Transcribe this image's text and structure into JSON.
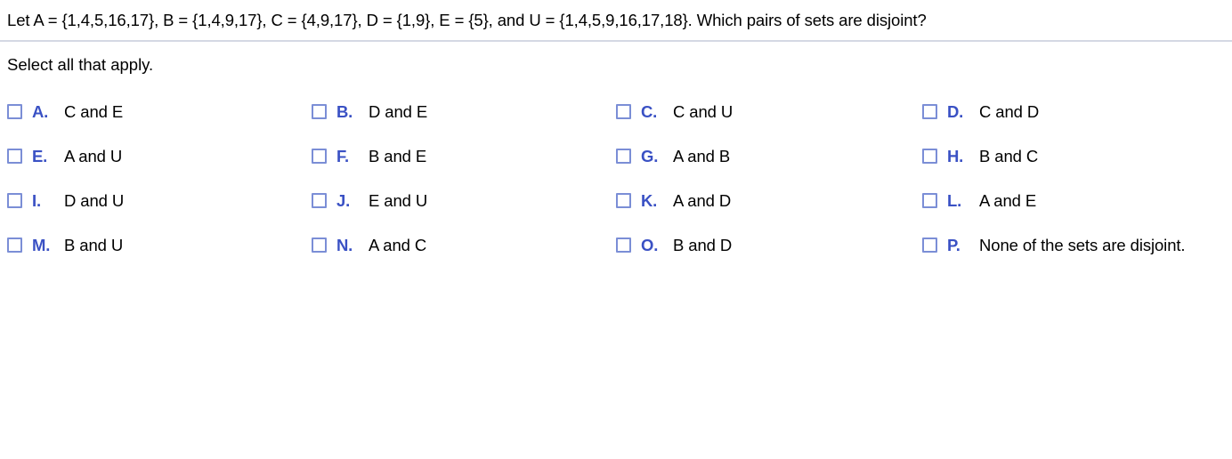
{
  "question": {
    "stem": "Let A = {1,4,5,16,17}, B = {1,4,9,17}, C = {4,9,17}, D = {1,9}, E = {5}, and U = {1,4,5,9,16,17,18}. Which pairs of sets are disjoint?",
    "instruction": "Select all that apply."
  },
  "colors": {
    "letter_blue": "#3a51c4",
    "checkbox_border": "#7b8ed6",
    "divider": "#d4d8e4",
    "text": "#000000"
  },
  "options": [
    {
      "letter": "A.",
      "text": "C and E",
      "checked": false
    },
    {
      "letter": "B.",
      "text": "D and E",
      "checked": false
    },
    {
      "letter": "C.",
      "text": "C and U",
      "checked": false
    },
    {
      "letter": "D.",
      "text": "C and D",
      "checked": false
    },
    {
      "letter": "E.",
      "text": "A and U",
      "checked": false
    },
    {
      "letter": "F.",
      "text": "B and E",
      "checked": false
    },
    {
      "letter": "G.",
      "text": "A and B",
      "checked": false
    },
    {
      "letter": "H.",
      "text": "B and C",
      "checked": false
    },
    {
      "letter": "I.",
      "text": "D and U",
      "checked": false
    },
    {
      "letter": "J.",
      "text": "E and U",
      "checked": false
    },
    {
      "letter": "K.",
      "text": "A and D",
      "checked": false
    },
    {
      "letter": "L.",
      "text": "A and E",
      "checked": false
    },
    {
      "letter": "M.",
      "text": "B and U",
      "checked": false
    },
    {
      "letter": "N.",
      "text": "A and C",
      "checked": false
    },
    {
      "letter": "O.",
      "text": "B and D",
      "checked": false
    },
    {
      "letter": "P.",
      "text": "None of the sets are disjoint.",
      "checked": false
    }
  ]
}
